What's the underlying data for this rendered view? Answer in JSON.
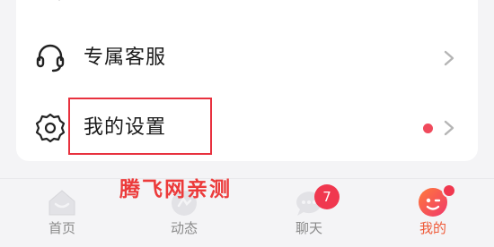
{
  "menu": {
    "items": [
      {
        "label": "专属客服",
        "icon": "headset-icon"
      },
      {
        "label": "我的设置",
        "icon": "gear-icon"
      }
    ]
  },
  "watermark": "腾飞网亲测",
  "tabbar": {
    "tabs": [
      {
        "label": "首页",
        "icon": "home-icon",
        "active": false
      },
      {
        "label": "动态",
        "icon": "moments-icon",
        "active": false
      },
      {
        "label": "聊天",
        "icon": "chat-bubble-icon",
        "active": false,
        "badge": "7"
      },
      {
        "label": "我的",
        "icon": "profile-face-icon",
        "active": true,
        "dot": true
      }
    ]
  },
  "colors": {
    "accent": "#ef5a38",
    "badge": "#f0384f",
    "highlight_border": "#e8313e",
    "watermark": "#ec3a3a"
  }
}
